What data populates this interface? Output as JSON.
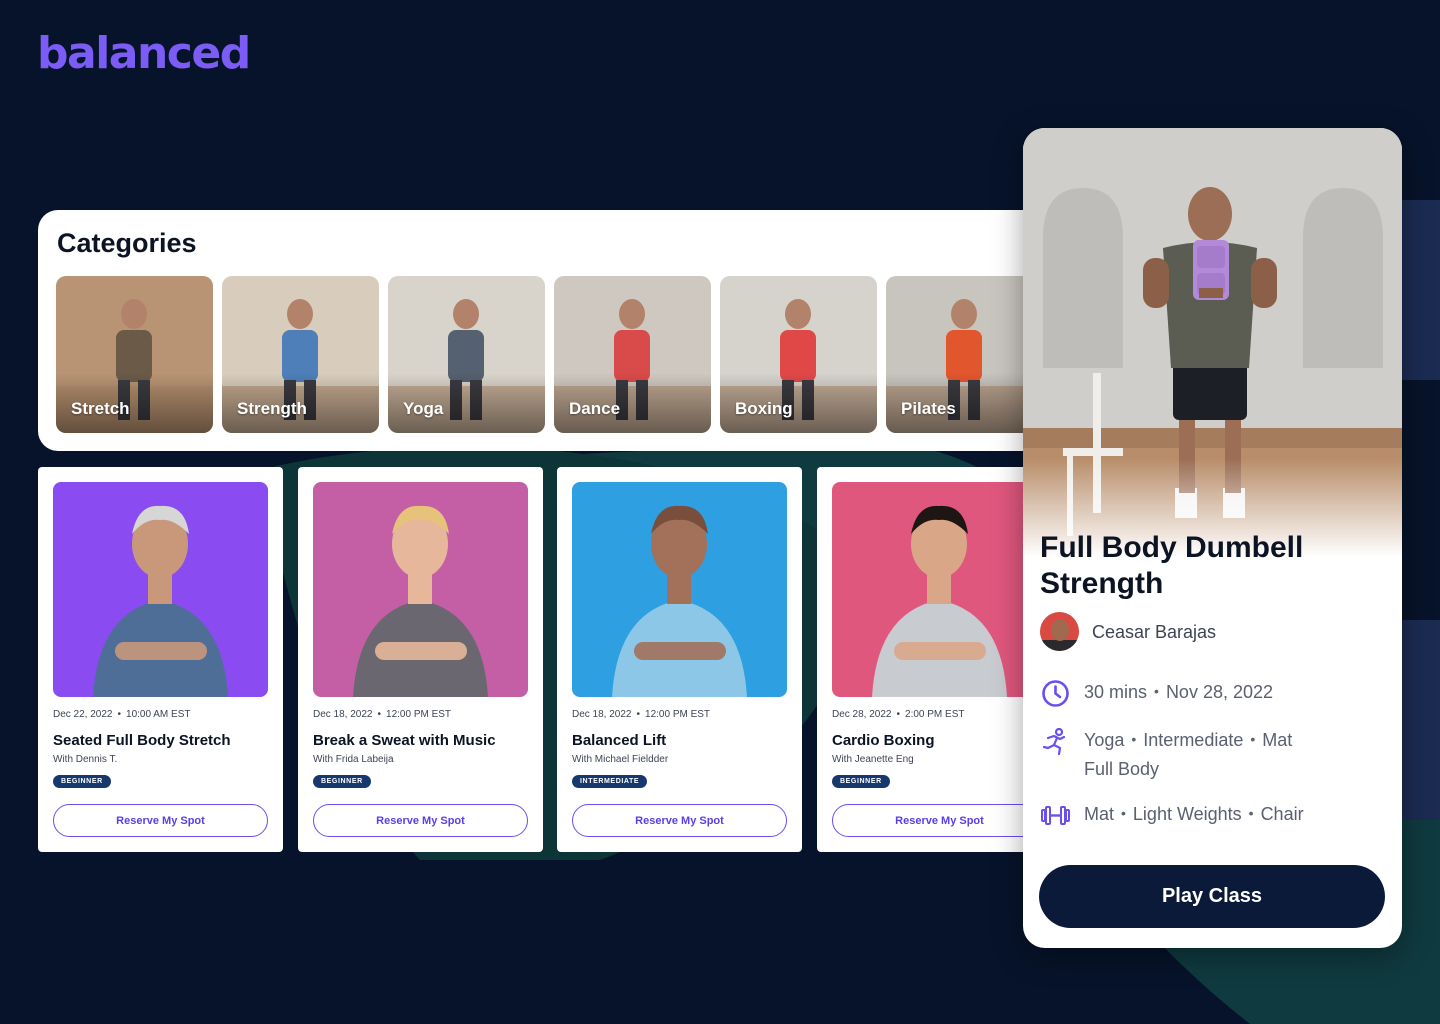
{
  "brand": {
    "logo_text": "balanced",
    "accent": "#7b5cf5",
    "background": "#07132a"
  },
  "categories": {
    "title": "Categories",
    "items": [
      {
        "label": "Stretch",
        "bg": "#b89474",
        "accent": "#6b5a48"
      },
      {
        "label": "Strength",
        "bg": "#d8cdbd",
        "accent": "#4e7fb8"
      },
      {
        "label": "Yoga",
        "bg": "#d9d4cb",
        "accent": "#556070"
      },
      {
        "label": "Dance",
        "bg": "#cfc8c0",
        "accent": "#d94a4a"
      },
      {
        "label": "Boxing",
        "bg": "#d6d2cc",
        "accent": "#e04848"
      },
      {
        "label": "Pilates",
        "bg": "#c8c4be",
        "accent": "#e2562e"
      }
    ]
  },
  "classes": [
    {
      "date": "Dec 22, 2022",
      "time": "10:00 AM EST",
      "title": "Seated Full Body Stretch",
      "instructor": "With Dennis T.",
      "level": "BEGINNER",
      "cta": "Reserve My Spot",
      "photo_bg": "#8a4cf0",
      "shirt": "#4e6e98",
      "skin": "#c9987a",
      "hair": "#d6d6d6"
    },
    {
      "date": "Dec 18, 2022",
      "time": "12:00 PM EST",
      "title": "Break a Sweat with Music",
      "instructor": "With Frida Labeija",
      "level": "BEGINNER",
      "cta": "Reserve My Spot",
      "photo_bg": "#c45fa6",
      "shirt": "#6a6770",
      "skin": "#e6b79a",
      "hair": "#e6c27a"
    },
    {
      "date": "Dec 18, 2022",
      "time": "12:00 PM EST",
      "title": "Balanced Lift",
      "instructor": "With Michael Fieldder",
      "level": "INTERMEDIATE",
      "cta": "Reserve My Spot",
      "photo_bg": "#2e9fe0",
      "shirt": "#8cc7e8",
      "skin": "#a3705a",
      "hair": "#7a4e3c"
    },
    {
      "date": "Dec 28, 2022",
      "time": "2:00 PM EST",
      "title": "Cardio Boxing",
      "instructor": "With Jeanette Eng",
      "level": "BEGINNER",
      "cta": "Reserve My Spot",
      "photo_bg": "#e0577e",
      "shirt": "#c8cbd0",
      "skin": "#d9a688",
      "hair": "#1e1612"
    }
  ],
  "detail": {
    "title": "Full Body Dumbell Strength",
    "instructor": "Ceasar Barajas",
    "duration": "30 mins",
    "date": "Nov 28, 2022",
    "tags_line1": [
      "Yoga",
      "Intermediate",
      "Mat"
    ],
    "tags_line2": "Full Body",
    "equipment": [
      "Mat",
      "Light Weights",
      "Chair"
    ],
    "cta": "Play Class",
    "icon_color": "#6a4ff0"
  }
}
